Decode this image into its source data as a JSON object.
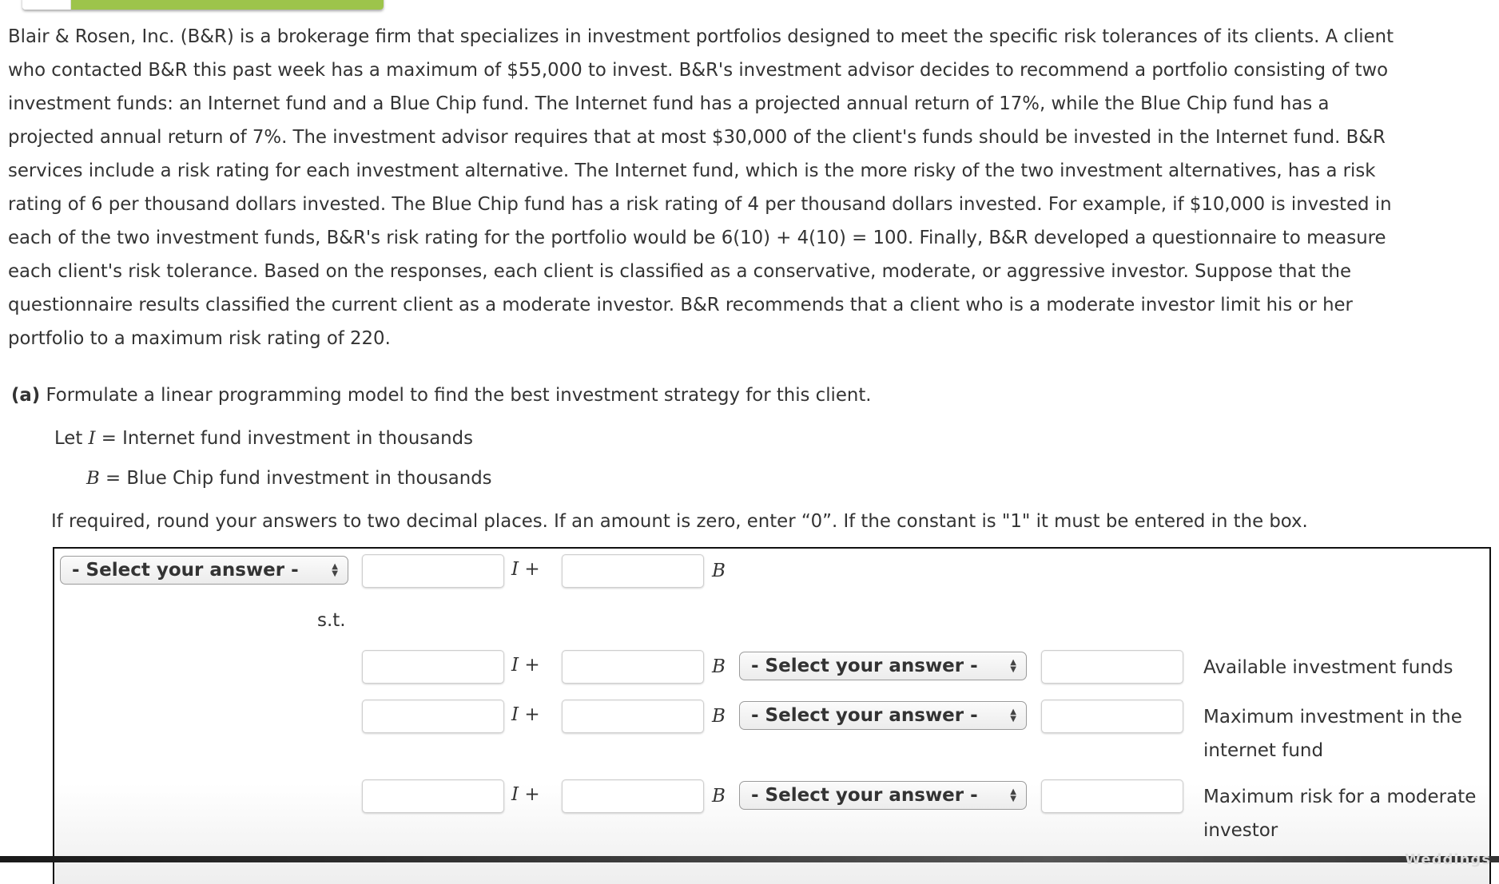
{
  "problem": {
    "paragraph_lines": [
      "Blair & Rosen, Inc. (B&R) is a brokerage firm that specializes in investment portfolios designed to meet the specific risk tolerances of its clients. A client",
      "who contacted B&R this past week has a maximum of $55,000 to invest. B&R's investment advisor decides to recommend a portfolio consisting of two",
      "investment funds: an Internet fund and a Blue Chip fund. The Internet fund has a projected annual return of 17%, while the Blue Chip fund has a",
      "projected annual return of 7%. The investment advisor requires that at most $30,000 of the client's funds should be invested in the Internet fund. B&R",
      "services include a risk rating for each investment alternative. The Internet fund, which is the more risky of the two investment alternatives, has a risk",
      "rating of 6 per thousand dollars invested. The Blue Chip fund has a risk rating of 4 per thousand dollars invested. For example, if $10,000 is invested in",
      "each of the two investment funds, B&R's risk rating for the portfolio would be 6(10) + 4(10) = 100. Finally, B&R developed a questionnaire to measure",
      "each client's risk tolerance. Based on the responses, each client is classified as a conservative, moderate, or aggressive investor. Suppose that the",
      "questionnaire results classified the current client as a moderate investor. B&R recommends that a client who is a moderate investor limit his or her",
      "portfolio to a maximum risk rating of 220."
    ]
  },
  "part_a": {
    "label": "(a)",
    "prompt": "Formulate a linear programming model to find the best investment strategy for this client.",
    "let_prefix": "Let",
    "var_I": "I",
    "def_I": "= Internet fund investment in thousands",
    "var_B": "B",
    "def_B": "= Blue Chip fund investment in thousands",
    "instructions": "If required, round your answers to two decimal places. If an amount is zero, enter “0”. If the constant is \"1\" it must be entered in the box."
  },
  "form": {
    "select_placeholder": "- Select your answer -",
    "st_label": "s.t.",
    "var_I_plus": "I  +",
    "var_B": "B",
    "objective": {
      "coef_I": "",
      "coef_B": ""
    },
    "constraints": [
      {
        "coef_I": "",
        "coef_B": "",
        "relation": "- Select your answer -",
        "rhs": "",
        "label": "Available investment funds"
      },
      {
        "coef_I": "",
        "coef_B": "",
        "relation": "- Select your answer -",
        "rhs": "",
        "label": "Maximum investment in the internet fund"
      },
      {
        "coef_I": "",
        "coef_B": "",
        "relation": "- Select your answer -",
        "rhs": "",
        "label": "Maximum risk for a moderate investor"
      }
    ]
  },
  "footer": {
    "brand_text": "Weddings"
  },
  "colors": {
    "accent_green": "#9dc44b",
    "text": "#333333"
  }
}
